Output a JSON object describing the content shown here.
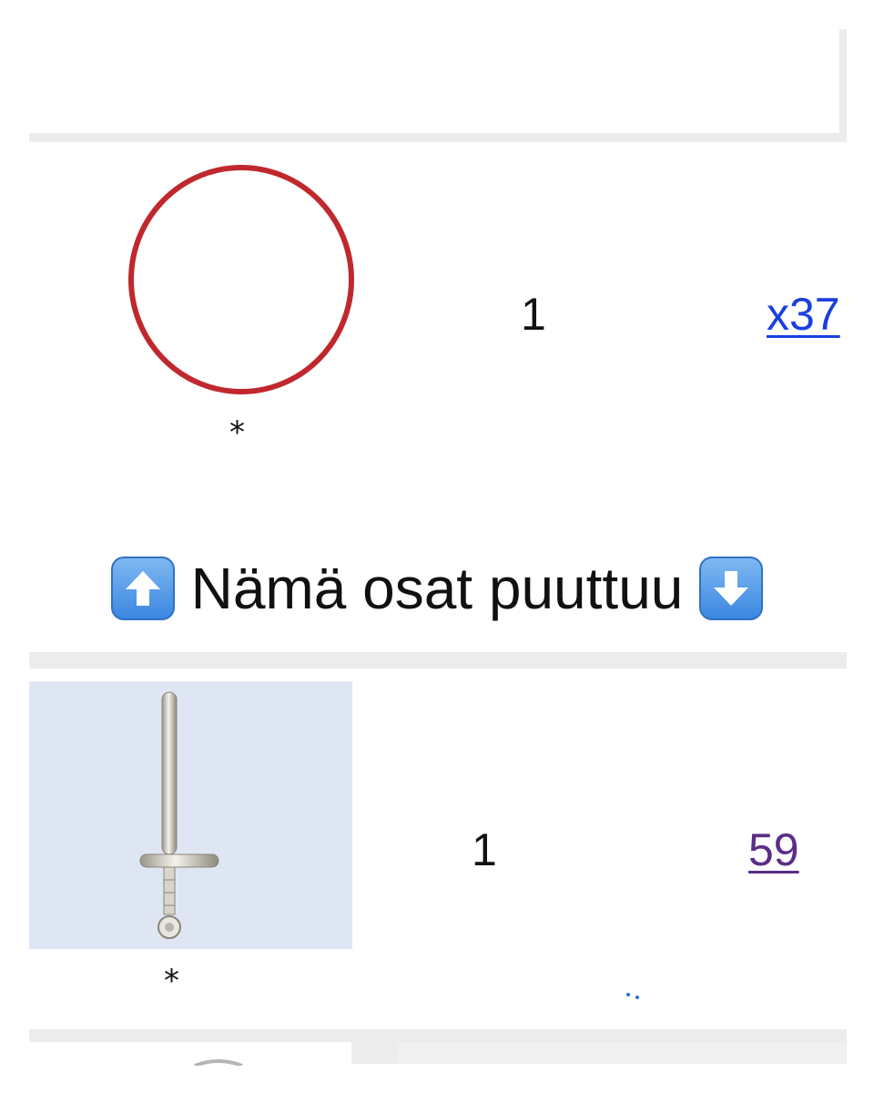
{
  "rows": [
    {
      "quantity": "1",
      "link_text": "x37",
      "note": "*",
      "image": "red-ring-part"
    },
    {
      "quantity": "1",
      "link_text": "59",
      "note": "*",
      "image": "silver-sword-part"
    }
  ],
  "heading": {
    "text": "Nämä osat puuttuu",
    "left_icon": "up-arrow-icon",
    "right_icon": "down-arrow-icon"
  },
  "colors": {
    "link": "#1a3fe0",
    "link_visited": "#5a2d86",
    "ring": "#c0282e",
    "emoji_button": "#3a87e0",
    "table_border": "#ececec"
  }
}
